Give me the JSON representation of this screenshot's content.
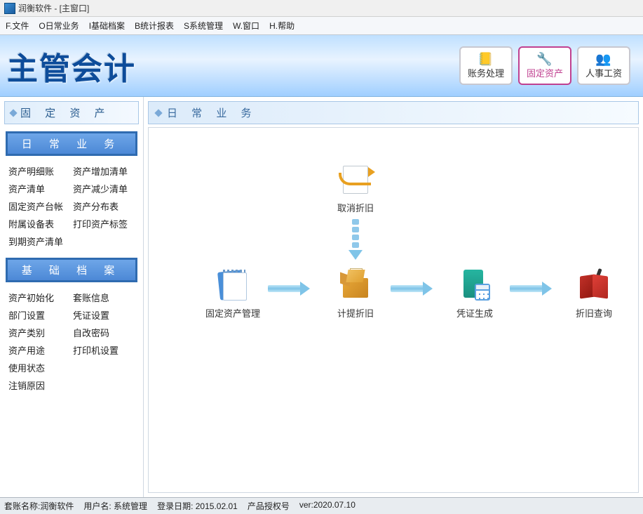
{
  "window": {
    "title": "润衡软件 - [主窗口]"
  },
  "menu": [
    "F.文件",
    "O日常业务",
    "I基础档案",
    "B统计报表",
    "S系统管理",
    "W.窗口",
    "H.帮助"
  ],
  "header": {
    "logo": "主管会计",
    "buttons": [
      {
        "label": "账务处理",
        "active": false
      },
      {
        "label": "固定资产",
        "active": true
      },
      {
        "label": "人事工资",
        "active": false
      }
    ]
  },
  "sidebar": {
    "panel_title": "固 定 资 产",
    "sections": [
      {
        "title": "日 常 业 务",
        "links": [
          "资产明细账",
          "资产增加清单",
          "资产清单",
          "资产减少清单",
          "固定资产台帐",
          "资产分布表",
          "附属设备表",
          "打印资产标签",
          "到期资产清单",
          ""
        ]
      },
      {
        "title": "基 础 档 案",
        "links": [
          "资产初始化",
          "套账信息",
          "部门设置",
          "凭证设置",
          "资产类别",
          "自改密码",
          "资产用途",
          "打印机设置",
          "使用状态",
          "",
          "注销原因",
          ""
        ]
      }
    ]
  },
  "main": {
    "title": "日 常 业 务",
    "nodes": {
      "cancel": "取消折旧",
      "manage": "固定资产管理",
      "depreciate": "计提折旧",
      "voucher": "凭证生成",
      "query": "折旧查询"
    }
  },
  "status": {
    "account_label": "套账名称:",
    "account_value": "润衡软件",
    "user_label": "用户名:",
    "user_value": "系统管理",
    "login_label": "登录日期:",
    "login_value": "2015.02.01",
    "license_label": "产品授权号",
    "version": "ver:2020.07.10"
  }
}
